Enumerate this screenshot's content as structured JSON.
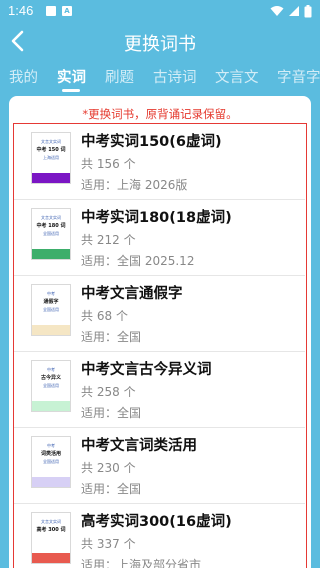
{
  "status": {
    "time": "1:46"
  },
  "header": {
    "title": "更换词书"
  },
  "tabs": [
    "我的",
    "实词",
    "刷题",
    "古诗词",
    "文言文",
    "字音字"
  ],
  "notice": "*更换词书，原背诵记录保留。",
  "count_prefix": "共",
  "count_suffix": "个",
  "scope_prefix": "适用：",
  "books": [
    {
      "title": "中考实词150(6虚词)",
      "count": "156",
      "scope": "上海 2026版",
      "cover_top": "文言文实词",
      "cover_main": "中考 150 词",
      "cover_sub": "上海适用",
      "band": "#7b16c4"
    },
    {
      "title": "中考实词180(18虚词)",
      "count": "212",
      "scope": "全国 2025.12",
      "cover_top": "文言文实词",
      "cover_main": "中考 180 词",
      "cover_sub": "全国适用",
      "band": "#3dae6b"
    },
    {
      "title": "中考文言通假字",
      "count": "68",
      "scope": "全国",
      "cover_top": "中考",
      "cover_main": "通假字",
      "cover_sub": "全国适用",
      "band": "#f5e6c4"
    },
    {
      "title": "中考文言古今异义词",
      "count": "258",
      "scope": "全国",
      "cover_top": "中考",
      "cover_main": "古今异义",
      "cover_sub": "全国适用",
      "band": "#c7f2d4"
    },
    {
      "title": "中考文言词类活用",
      "count": "230",
      "scope": "全国",
      "cover_top": "中考",
      "cover_main": "词类活用",
      "cover_sub": "全国适用",
      "band": "#d7d0f5"
    },
    {
      "title": "高考实词300(16虚词)",
      "count": "337",
      "scope": "上海及部分省市",
      "cover_top": "文言文实词",
      "cover_main": "高考 300 词",
      "cover_sub": "",
      "band": "#e85a4f"
    }
  ]
}
